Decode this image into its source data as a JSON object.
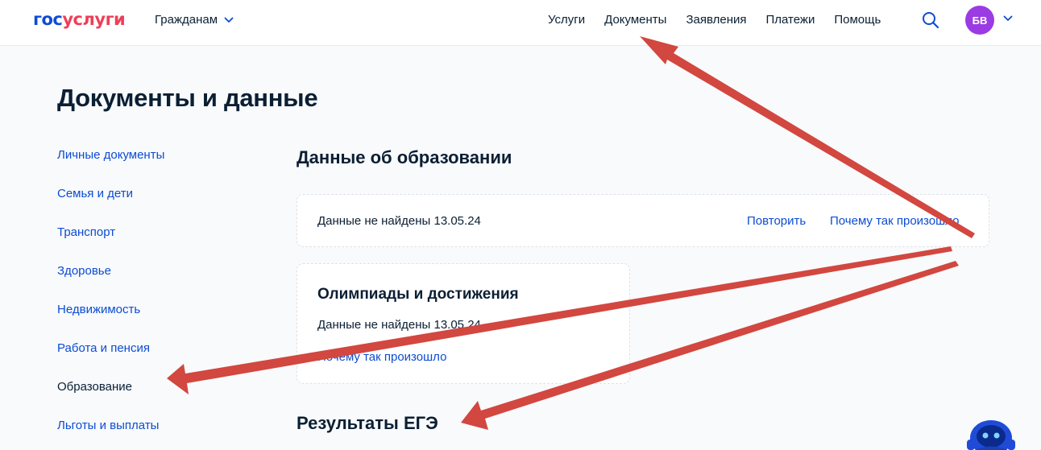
{
  "header": {
    "logo_part1": "гос",
    "logo_part2": "услуги",
    "audience_label": "Гражданам",
    "nav": [
      "Услуги",
      "Документы",
      "Заявления",
      "Платежи",
      "Помощь"
    ],
    "avatar_initials": "БВ",
    "avatar_color": "#9b3be4"
  },
  "page": {
    "title": "Документы и данные"
  },
  "sidebar": {
    "items": [
      {
        "label": "Личные документы"
      },
      {
        "label": "Семья и дети"
      },
      {
        "label": "Транспорт"
      },
      {
        "label": "Здоровье"
      },
      {
        "label": "Недвижимость"
      },
      {
        "label": "Работа и пенсия"
      },
      {
        "label": "Образование"
      },
      {
        "label": "Льготы и выплаты"
      }
    ]
  },
  "main": {
    "education_title": "Данные об образовании",
    "education_card": {
      "status": "Данные не найдены 13.05.24",
      "retry_link": "Повторить",
      "why_link": "Почему так произошло"
    },
    "olympiad_card": {
      "title": "Олимпиады и достижения",
      "status": "Данные не найдены 13.05.24",
      "why_link": "Почему так произошло"
    },
    "ege_title": "Результаты ЕГЭ"
  },
  "colors": {
    "brand_blue": "#0d4cd3",
    "brand_red": "#ee3f58",
    "annotation_arrow": "#d2473f"
  }
}
